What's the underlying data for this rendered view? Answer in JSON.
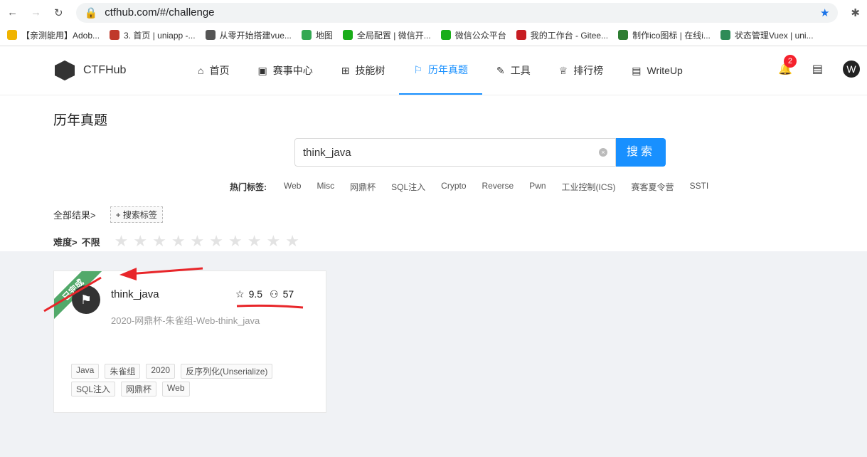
{
  "browser": {
    "url": "ctfhub.com/#/challenge"
  },
  "bookmarks": [
    {
      "label": "【亲测能用】Adob...",
      "color": "#f0b400"
    },
    {
      "label": "3. 首页 | uniapp -...",
      "color": "#c0392b"
    },
    {
      "label": "从零开始搭建vue...",
      "color": "#555"
    },
    {
      "label": "地图",
      "color": "#34a853"
    },
    {
      "label": "全局配置 | 微信开...",
      "color": "#1aad19"
    },
    {
      "label": "微信公众平台",
      "color": "#1aad19"
    },
    {
      "label": "我的工作台 - Gitee...",
      "color": "#c71d23"
    },
    {
      "label": "制作ico图标 | 在线i...",
      "color": "#2e7d32"
    },
    {
      "label": "状态管理Vuex | uni...",
      "color": "#2e8b57"
    }
  ],
  "nav": {
    "brand": "CTFHub",
    "items": [
      {
        "label": "首页",
        "icon": "⌂"
      },
      {
        "label": "赛事中心",
        "icon": "▣"
      },
      {
        "label": "技能树",
        "icon": "⊞"
      },
      {
        "label": "历年真题",
        "icon": "⚐",
        "active": true
      },
      {
        "label": "工具",
        "icon": "✎"
      },
      {
        "label": "排行榜",
        "icon": "♕"
      },
      {
        "label": "WriteUp",
        "icon": "▤"
      }
    ],
    "notifications": "2",
    "avatar": "W",
    "accent": "#1890ff"
  },
  "page": {
    "title": "历年真题",
    "search_value": "think_java",
    "search_button": "搜索",
    "hot_label": "热门标签:",
    "hot_tags": [
      "Web",
      "Misc",
      "网鼎杯",
      "SQL注入",
      "Crypto",
      "Reverse",
      "Pwn",
      "工业控制(ICS)",
      "赛客夏令营",
      "SSTI"
    ],
    "all_results": "全部结果>",
    "search_tag": "+ 搜索标签",
    "difficulty_label": "难度>",
    "difficulty_value": "不限",
    "difficulty_stars": 10
  },
  "card": {
    "ribbon": "已完成",
    "name": "think_java",
    "rating": "9.5",
    "solvers": "57",
    "description": "2020-网鼎杯-朱雀组-Web-think_java",
    "tags": [
      "Java",
      "朱雀组",
      "2020",
      "反序列化(Unserialize)",
      "SQL注入",
      "网鼎杯",
      "Web"
    ]
  }
}
